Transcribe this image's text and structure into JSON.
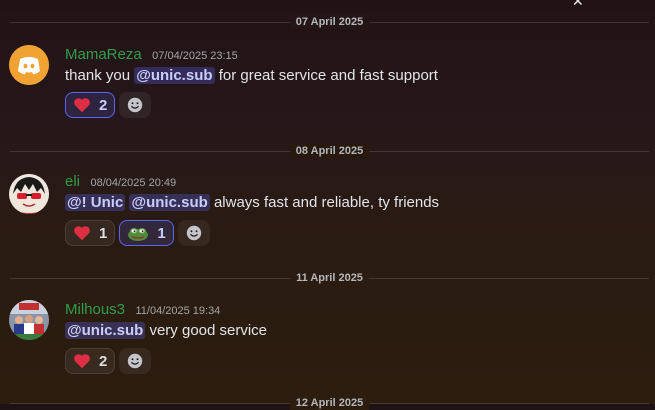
{
  "dividers": [
    "07 April 2025",
    "08 April 2025",
    "11 April 2025",
    "12 April 2025"
  ],
  "messages": [
    {
      "username": "MamaReza",
      "timestamp": "07/04/2025 23:15",
      "mentions": [
        "@unic.sub"
      ],
      "text_before": "thank you",
      "text_after": "for great service and fast support",
      "reactions": [
        {
          "emoji": "heart",
          "count": "2",
          "active": true
        }
      ]
    },
    {
      "username": "eli",
      "timestamp": "08/04/2025 20:49",
      "mentions": [
        "@! Unic",
        "@unic.sub"
      ],
      "text_after": "always fast and reliable, ty friends",
      "reactions": [
        {
          "emoji": "heart",
          "count": "1",
          "active": false
        },
        {
          "emoji": "pepe-frog",
          "count": "1",
          "active": true
        }
      ]
    },
    {
      "username": "Milhous3",
      "timestamp": "11/04/2025 19:34",
      "mentions": [
        "@unic.sub"
      ],
      "text_after": "very good service",
      "reactions": [
        {
          "emoji": "heart",
          "count": "2",
          "active": false
        }
      ]
    }
  ],
  "colors": {
    "username": "#2f9e4a",
    "mention_bg": "#4a4f8f",
    "accent": "#5865f2",
    "discord_avatar_bg": "#f0a232"
  }
}
